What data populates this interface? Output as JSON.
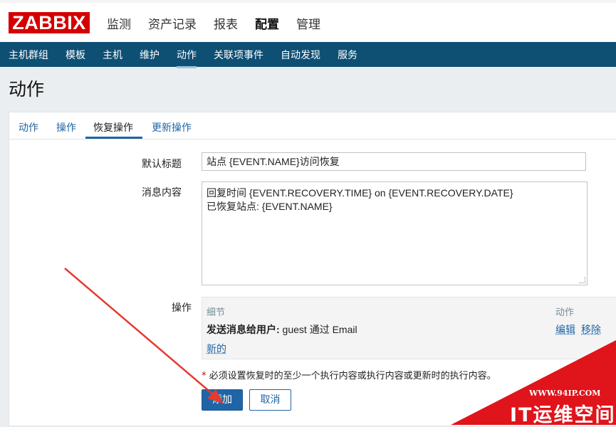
{
  "header": {
    "logo": "ZABBIX",
    "nav": [
      "监测",
      "资产记录",
      "报表",
      "配置",
      "管理"
    ],
    "nav_active": "配置"
  },
  "subnav": {
    "items": [
      "主机群组",
      "模板",
      "主机",
      "维护",
      "动作",
      "关联项事件",
      "自动发现",
      "服务"
    ],
    "active": "动作"
  },
  "page": {
    "title": "动作"
  },
  "tabs": {
    "t1": "动作",
    "t2": "操作",
    "t3": "恢复操作",
    "t4": "更新操作",
    "active": "恢复操作"
  },
  "form": {
    "subject_label": "默认标题",
    "subject_value": "站点 {EVENT.NAME}访问恢复",
    "message_label": "消息内容",
    "message_line1": "回复时间 {EVENT.RECOVERY.TIME} on {EVENT.RECOVERY.DATE}",
    "message_line2": "已恢复站点: {EVENT.NAME}",
    "operations_label": "操作",
    "ops_col_details": "细节",
    "ops_col_action": "动作",
    "op_bold": "发送消息给用户:",
    "op_rest": " guest 通过 Email",
    "op_edit": "编辑",
    "op_remove": "移除",
    "op_new": "新的",
    "note_star": "*",
    "note_text": " 必须设置恢复时的至少一个执行内容或执行内容或更新时的执行内容。",
    "btn_add": "添加",
    "btn_cancel": "取消"
  },
  "watermark": {
    "site": "WWW.94IP.COM",
    "text": "IT运维空间"
  },
  "colors": {
    "brand": "#d40000",
    "nav_bg": "#0e4f74",
    "link": "#1f65a6",
    "arrow": "#e53a2f"
  }
}
